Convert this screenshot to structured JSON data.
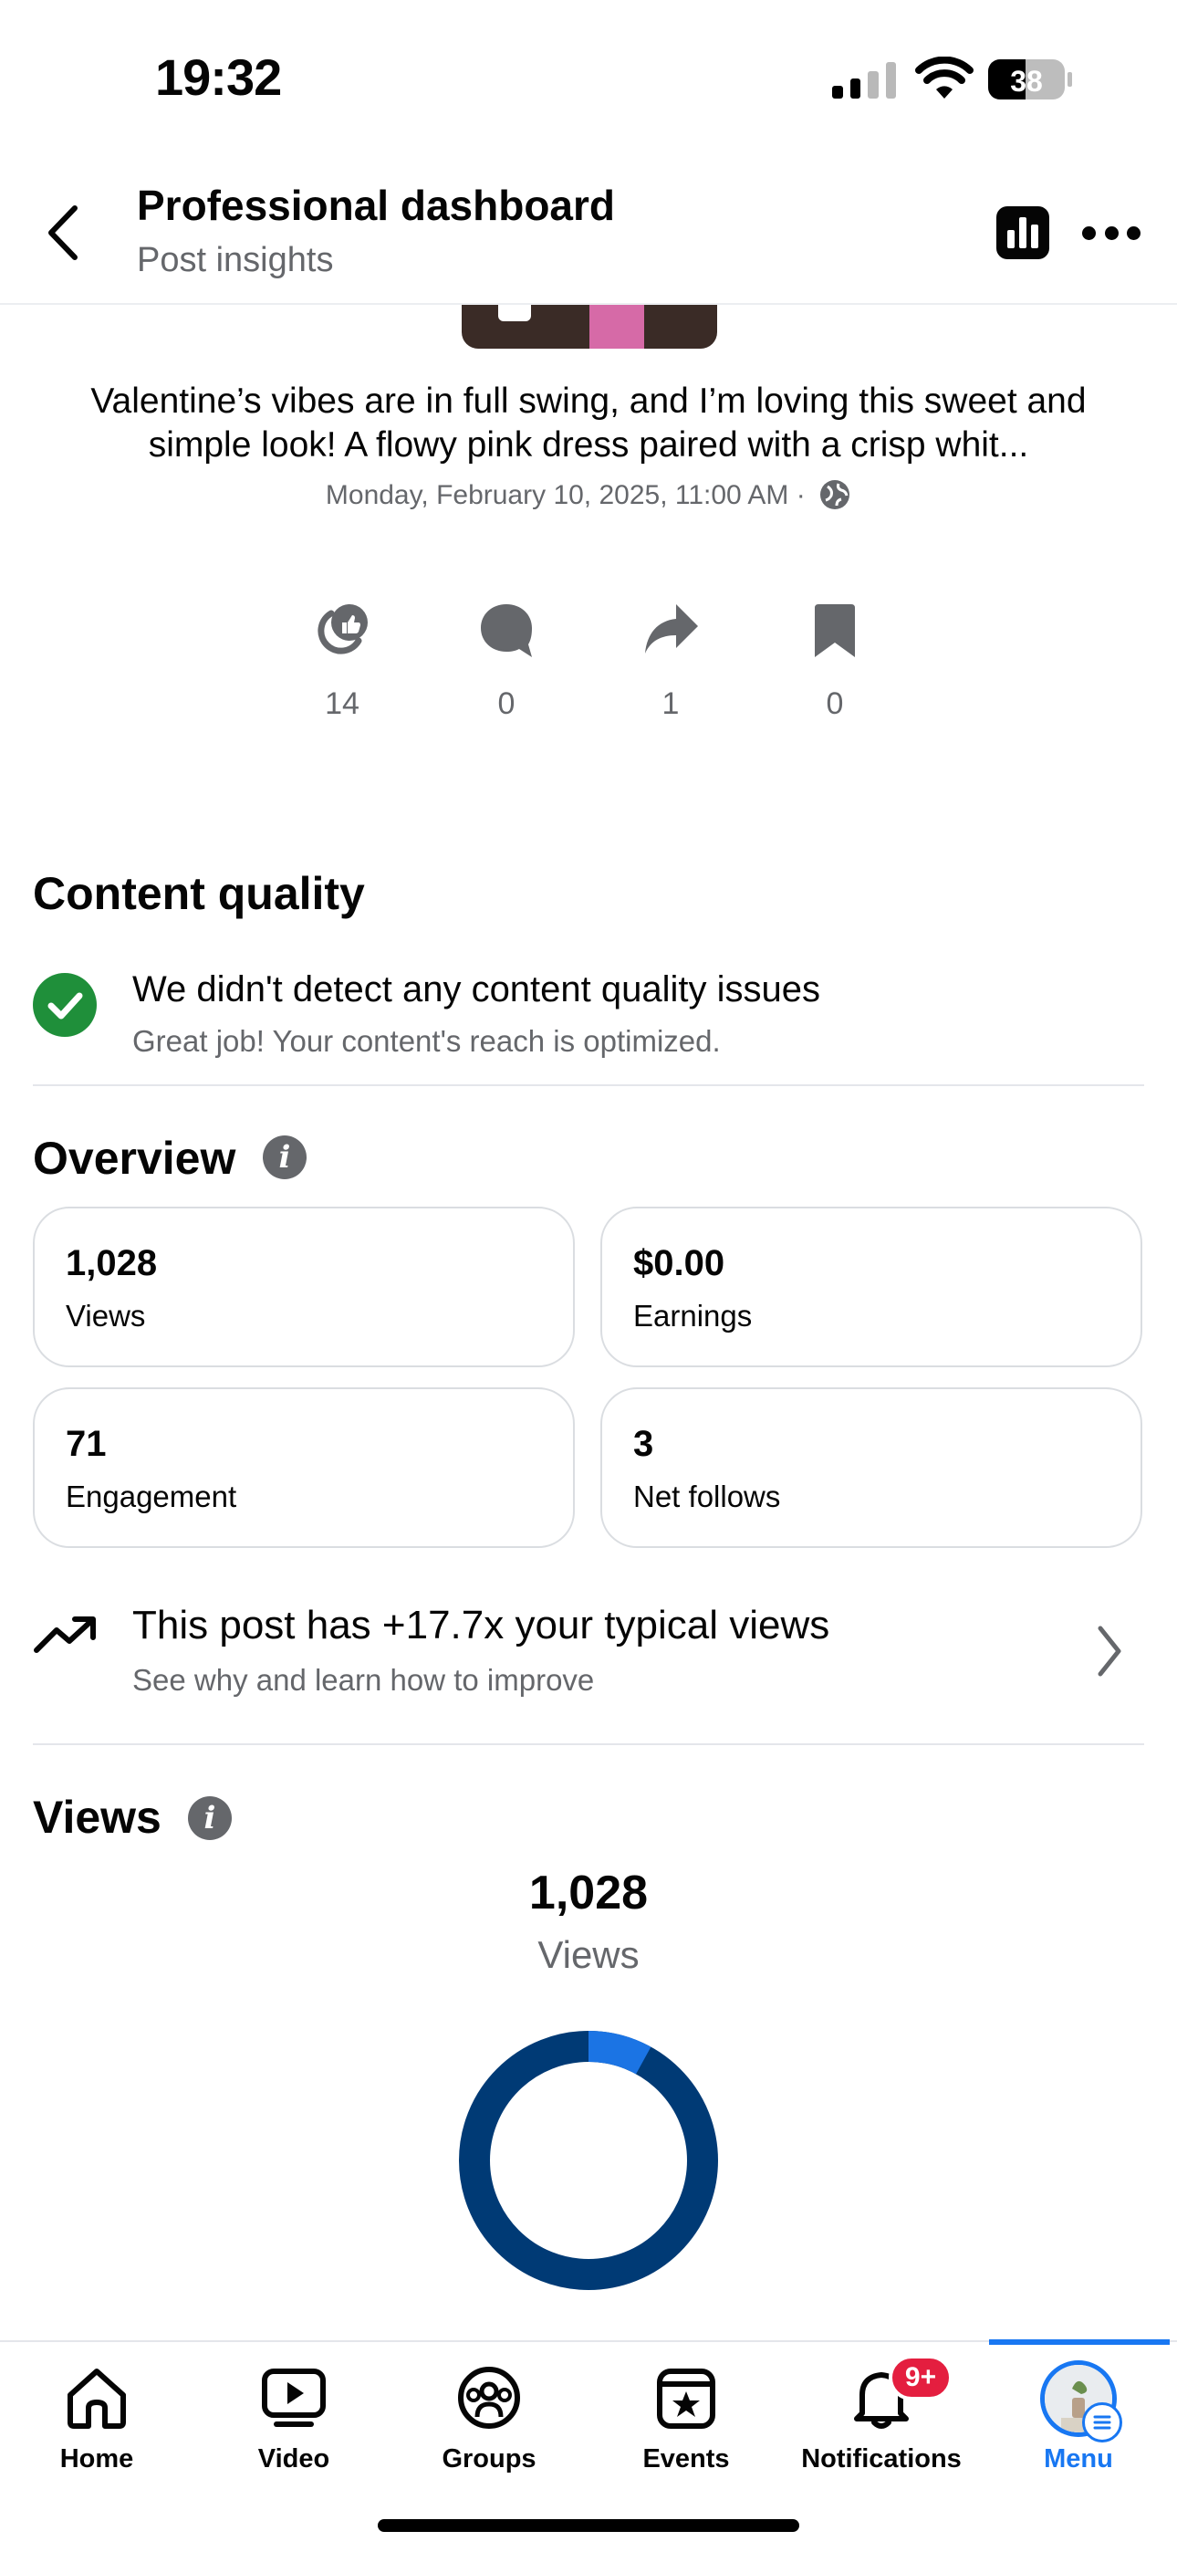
{
  "status_bar": {
    "time": "19:32",
    "battery": "38"
  },
  "header": {
    "title": "Professional dashboard",
    "subtitle": "Post insights"
  },
  "post": {
    "caption": "Valentine’s vibes are in full swing, and I’m loving this sweet and simple look! A flowy pink dress paired with a crisp whit...",
    "date": "Monday, February 10, 2025, 11:00 AM ·"
  },
  "reactions": [
    {
      "icon": "like-icon",
      "count": "14"
    },
    {
      "icon": "comment-icon",
      "count": "0"
    },
    {
      "icon": "share-icon",
      "count": "1"
    },
    {
      "icon": "bookmark-icon",
      "count": "0"
    }
  ],
  "content_quality": {
    "heading": "Content quality",
    "title": "We didn't detect any content quality issues",
    "subtitle": "Great job! Your content's reach is optimized."
  },
  "overview": {
    "heading": "Overview",
    "cards": [
      {
        "value": "1,028",
        "label": "Views"
      },
      {
        "value": "$0.00",
        "label": "Earnings"
      },
      {
        "value": "71",
        "label": "Engagement"
      },
      {
        "value": "3",
        "label": "Net follows"
      }
    ]
  },
  "typical_views": {
    "title": "This post has +17.7x your typical views",
    "subtitle": "See why and learn how to improve"
  },
  "views_section": {
    "heading": "Views",
    "total": "1,028",
    "total_label": "Views",
    "donut": {
      "highlight_fraction": 0.08,
      "highlight_color": "#1b74e4",
      "base_color": "#003a75"
    }
  },
  "tabs": [
    {
      "label": "Home",
      "icon": "home-icon"
    },
    {
      "label": "Video",
      "icon": "video-icon"
    },
    {
      "label": "Groups",
      "icon": "groups-icon"
    },
    {
      "label": "Events",
      "icon": "events-icon"
    },
    {
      "label": "Notifications",
      "icon": "bell-icon",
      "badge": "9+"
    },
    {
      "label": "Menu",
      "icon": "avatar",
      "active": true
    }
  ],
  "colors": {
    "accent": "#1877f2",
    "success": "#1f8f3a",
    "badge": "#e41e3f"
  }
}
